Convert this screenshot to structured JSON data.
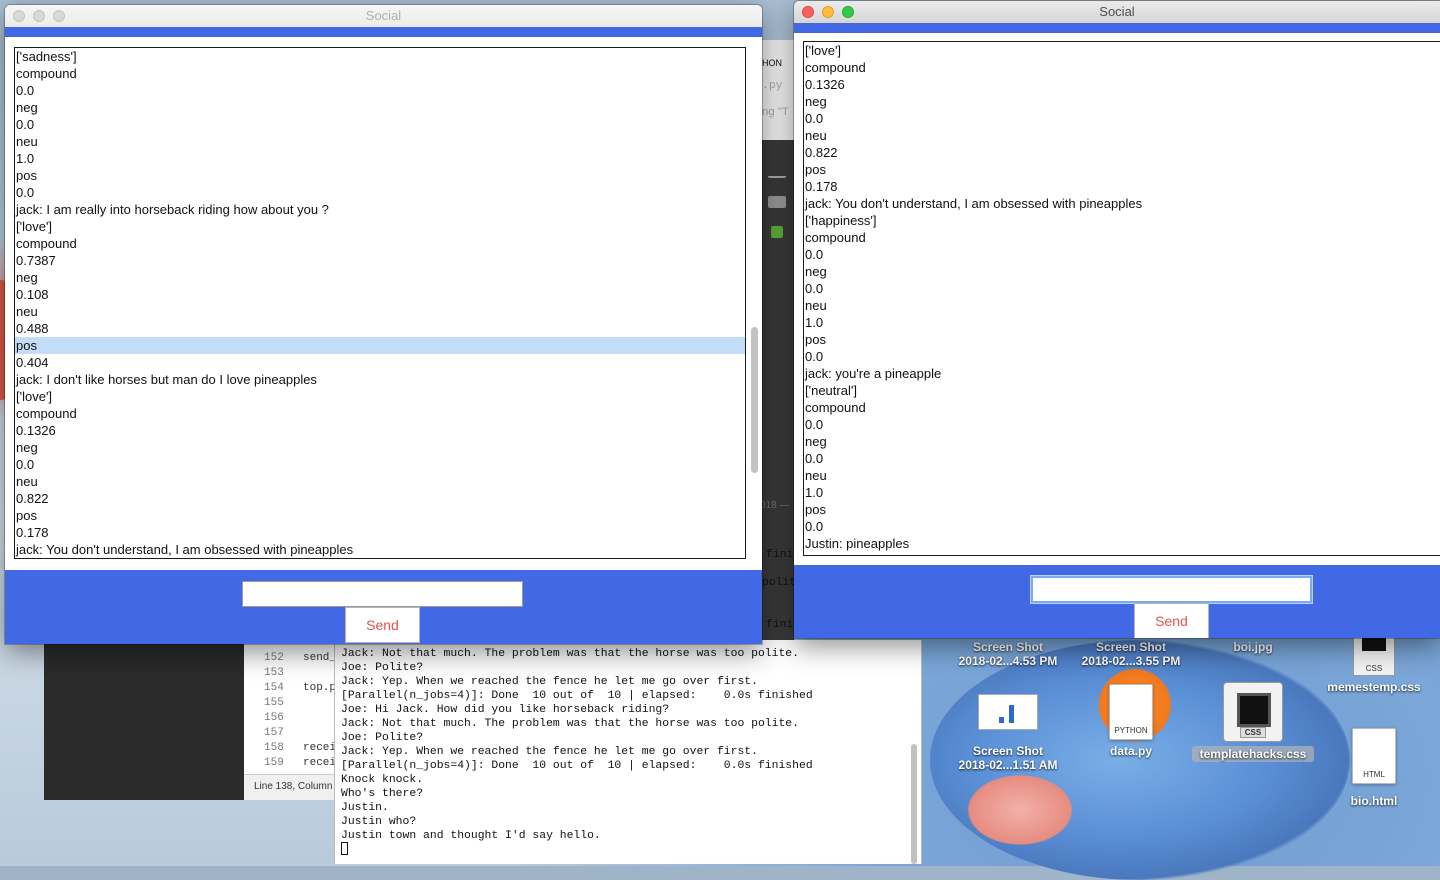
{
  "desktop": {
    "icons": [
      {
        "id": "screenshot1",
        "line1": "Screen Shot",
        "line2": "2018-02...4.53 PM"
      },
      {
        "id": "screenshot2",
        "line1": "Screen Shot",
        "line2": "2018-02...3.55 PM"
      },
      {
        "id": "boi",
        "line1": "boi.jpg",
        "line2": ""
      },
      {
        "id": "memestemp",
        "line1": "memestemp.css",
        "line2": ""
      },
      {
        "id": "screenshot3",
        "line1": "Screen Shot",
        "line2": "2018-02...1.51 AM"
      },
      {
        "id": "data",
        "line1": "data.py",
        "line2": ""
      },
      {
        "id": "templatehacks",
        "line1": "templatehacks.css",
        "line2": ""
      },
      {
        "id": "bio",
        "line1": "bio.html",
        "line2": ""
      }
    ],
    "file_type_python": "PYTHON",
    "file_type_css": "CSS",
    "file_type_html": "HTML"
  },
  "editor": {
    "line_numbers": [
      "152",
      "153",
      "154",
      "155",
      "156",
      "157",
      "158",
      "159"
    ],
    "code": [
      "send_",
      "",
      "top.p",
      "",
      "",
      "",
      "recei",
      "recei"
    ],
    "status": "Line 138, Column"
  },
  "background_peeks": {
    "python_label": "HON",
    "py_tab": ".py",
    "ng": "ng \"T",
    "date": "018 —",
    "fini1": "fini",
    "polit": "polit",
    "fini2": "fini"
  },
  "terminal": {
    "lines": [
      "Jack: Not that much. The problem was that the horse was too polite.",
      "Joe: Polite?",
      "Jack: Yep. When we reached the fence he let me go over first.",
      "[Parallel(n_jobs=4)]: Done  10 out of  10 | elapsed:    0.0s finished",
      "Joe: Hi Jack. How did you like horseback riding?",
      "Jack: Not that much. The problem was that the horse was too polite.",
      "Joe: Polite?",
      "Jack: Yep. When we reached the fence he let me go over first.",
      "[Parallel(n_jobs=4)]: Done  10 out of  10 | elapsed:    0.0s finished",
      "Knock knock.",
      "Who's there?",
      "Justin.",
      "Justin who?",
      "Justin town and thought I'd say hello."
    ]
  },
  "left_window": {
    "title": "Social",
    "rows": [
      "['sadness']",
      "compound",
      "0.0",
      "neg",
      "0.0",
      "neu",
      "1.0",
      "pos",
      "0.0",
      "jack: I am really into horseback riding how about you ?",
      "['love']",
      "compound",
      "0.7387",
      "neg",
      "0.108",
      "neu",
      "0.488",
      "pos",
      "0.404",
      "jack: I don't like horses but man do I love pineapples",
      "['love']",
      "compound",
      "0.1326",
      "neg",
      "0.0",
      "neu",
      "0.822",
      "pos",
      "0.178",
      "jack: You don't understand, I am obsessed with pineapples"
    ],
    "selected_index": 17,
    "input_value": "",
    "send_label": "Send"
  },
  "right_window": {
    "title": "Social",
    "rows": [
      "['love']",
      "compound",
      "0.1326",
      "neg",
      "0.0",
      "neu",
      "0.822",
      "pos",
      "0.178",
      "jack: You don't understand, I am obsessed with pineapples",
      "['happiness']",
      "compound",
      "0.0",
      "neg",
      "0.0",
      "neu",
      "1.0",
      "pos",
      "0.0",
      "jack: you're a pineapple",
      "['neutral']",
      "compound",
      "0.0",
      "neg",
      "0.0",
      "neu",
      "1.0",
      "pos",
      "0.0",
      "Justin: pineapples"
    ],
    "input_value": "",
    "send_label": "Send"
  },
  "colors": {
    "accent_blue": "#4169e6",
    "send_text": "#e2554a",
    "selection": "#c3dcf7",
    "traffic_close": "#fc605c",
    "traffic_min": "#fdbc40",
    "traffic_max": "#34c84a"
  }
}
